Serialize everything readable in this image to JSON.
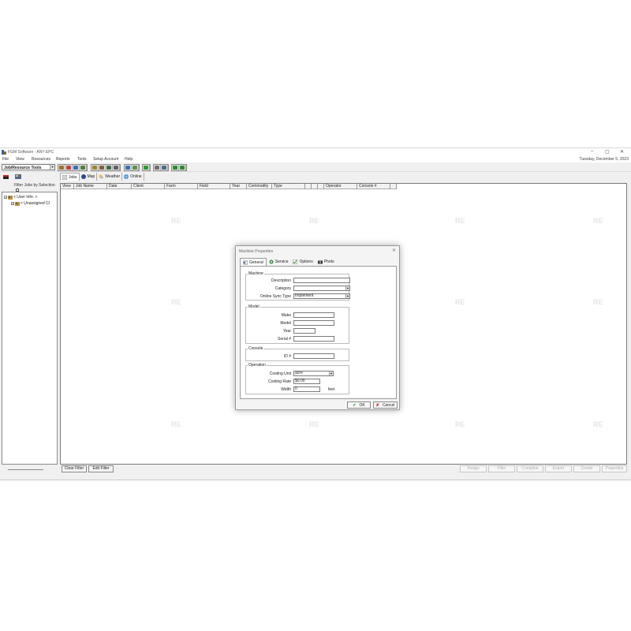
{
  "window": {
    "title": "FGM Software - ANY EPC",
    "minimize": "–",
    "maximize": "▢",
    "close": "✕"
  },
  "menu": {
    "items": [
      "File",
      "View",
      "Resources",
      "Reports",
      "Tools",
      "Setup Account",
      "Help"
    ],
    "date": "Tuesday, December 5, 2023"
  },
  "toolbar": {
    "combo_value": "Job/Resource Tools"
  },
  "sidebar": {
    "filter_label": "Filter Jobs by Selection",
    "tree": [
      {
        "label": "< User Info. >",
        "expander": "−"
      },
      {
        "label": "< Unassigned Cl",
        "expander": "+"
      }
    ]
  },
  "main": {
    "tabs": [
      {
        "label": "Jobs",
        "icon": "jobs-icon"
      },
      {
        "label": "Map",
        "icon": "map-icon"
      },
      {
        "label": "Weather",
        "icon": "weather-icon"
      },
      {
        "label": "Online",
        "icon": "online-icon"
      }
    ],
    "columns": [
      "View",
      "Job Name",
      "Date",
      "Client",
      "Farm",
      "Field",
      "Year",
      "Commodity",
      "Type",
      "",
      "",
      "",
      "Operator",
      "Console #",
      ""
    ],
    "watermark": "RE"
  },
  "bottom": {
    "clear_filter": "Clear Filter",
    "edit_filter": "Edit Filter",
    "right_buttons": [
      "Assign",
      "Filter",
      "Complete",
      "Export",
      "Create",
      "Properties"
    ]
  },
  "dialog": {
    "title": "Machine Properties",
    "close": "✕",
    "tabs": [
      {
        "label": "General"
      },
      {
        "label": "Service"
      },
      {
        "label": "Options"
      },
      {
        "label": "Photo"
      }
    ],
    "machine": {
      "title": "Machine",
      "description_label": "Description",
      "description_value": "",
      "category_label": "Category",
      "category_value": "",
      "sync_label": "Online Sync Type",
      "sync_value": "Implement"
    },
    "model": {
      "title": "Model",
      "make_label": "Make",
      "model_label": "Model",
      "year_label": "Year",
      "serial_label": "Serial #"
    },
    "console": {
      "title": "Console",
      "id_label": "ID #"
    },
    "operation": {
      "title": "Operation",
      "costing_unit_label": "Costing Unit",
      "costing_unit_value": "acre",
      "costing_rate_label": "Costing Rate",
      "costing_rate_value": "$0.00",
      "width_label": "Width",
      "width_value": "0",
      "width_unit": "feet"
    },
    "ok_label": "OK",
    "cancel_label": "Cancel"
  },
  "colors": {
    "accent_green": "#2e8b2e",
    "cancel_red": "#cc2222",
    "window_bg": "#f0f0f0"
  }
}
